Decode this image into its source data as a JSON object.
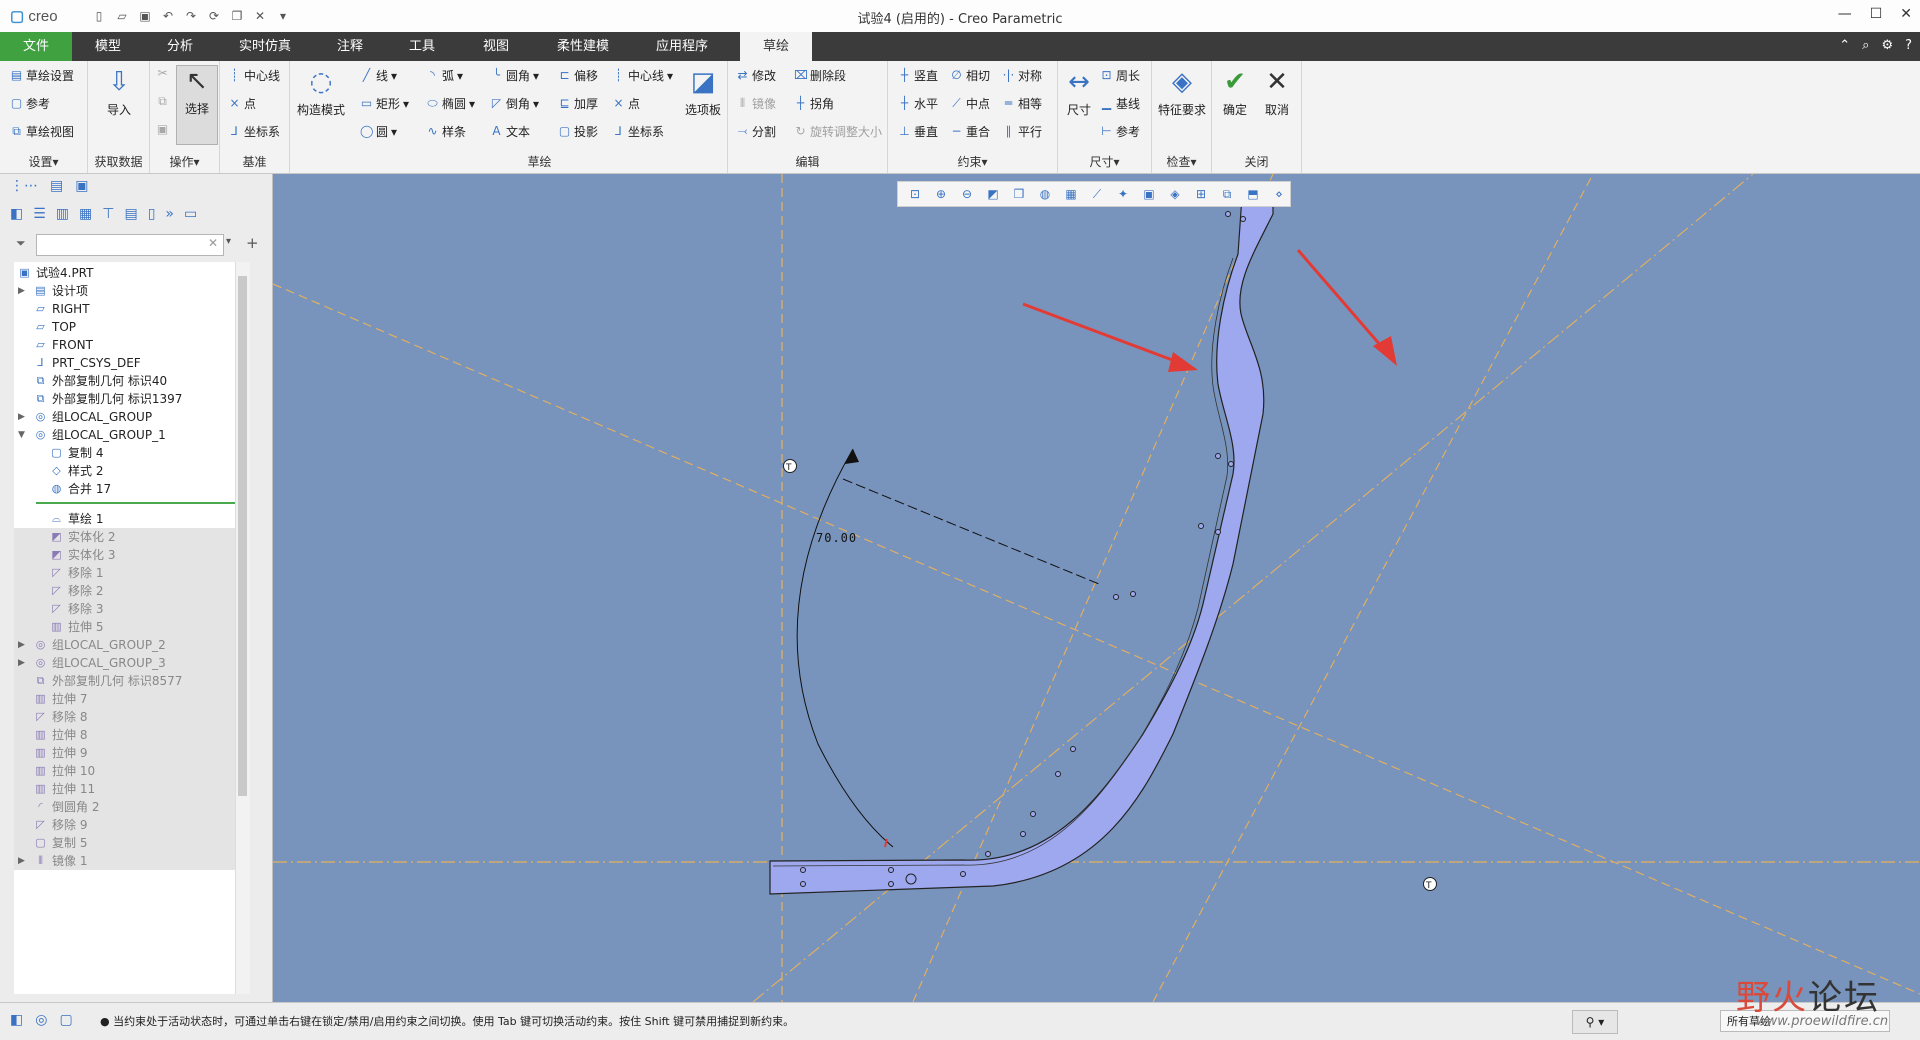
{
  "app": {
    "logo": "creo",
    "title": "试验4 (启用的) - Creo Parametric",
    "window_controls": [
      "minimize-icon",
      "maximize-icon",
      "close-icon"
    ]
  },
  "tabs": [
    {
      "label": "文件"
    },
    {
      "label": "模型"
    },
    {
      "label": "分析"
    },
    {
      "label": "实时仿真"
    },
    {
      "label": "注释"
    },
    {
      "label": "工具"
    },
    {
      "label": "视图"
    },
    {
      "label": "柔性建模"
    },
    {
      "label": "应用程序"
    },
    {
      "label": "草绘"
    }
  ],
  "ribbon": {
    "setup": {
      "label": "设置▾",
      "items": [
        "草绘设置",
        "参考",
        "草绘视图"
      ]
    },
    "getdata": {
      "label": "获取数据",
      "import": "导入"
    },
    "ops": {
      "label": "操作▾",
      "select": "选择"
    },
    "datum": {
      "label": "基准",
      "items": [
        "中心线",
        "点",
        "坐标系"
      ]
    },
    "construct": {
      "label": "构造模式"
    },
    "sketch": {
      "label": "草绘",
      "items": [
        "线",
        "弧",
        "圆角",
        "偏移",
        "中心线",
        "矩形",
        "椭圆",
        "倒角",
        "加厚",
        "点",
        "圆",
        "样条",
        "文本",
        "投影",
        "坐标系"
      ],
      "palette": "选项板"
    },
    "edit": {
      "label": "编辑",
      "items": [
        "修改",
        "删除段",
        "镜像",
        "拐角",
        "分割",
        "旋转调整大小"
      ]
    },
    "constrain": {
      "label": "约束▾",
      "items": [
        "竖直",
        "相切",
        "对称",
        "水平",
        "中点",
        "相等",
        "垂直",
        "重合",
        "平行"
      ]
    },
    "dimension": {
      "label": "尺寸▾",
      "dim": "尺寸",
      "items": [
        "周长",
        "基线",
        "参考"
      ]
    },
    "inspect": {
      "label": "检查▾",
      "feature_req": "特征要求"
    },
    "close": {
      "label": "关闭",
      "ok": "确定",
      "cancel": "取消"
    }
  },
  "tree": {
    "filter_placeholder": "",
    "items": [
      {
        "label": "试验4.PRT",
        "icon": "part-icon"
      },
      {
        "label": "设计项",
        "icon": "design-items-icon"
      },
      {
        "label": "RIGHT",
        "icon": "datum-plane-icon"
      },
      {
        "label": "TOP",
        "icon": "datum-plane-icon"
      },
      {
        "label": "FRONT",
        "icon": "datum-plane-icon"
      },
      {
        "label": "PRT_CSYS_DEF",
        "icon": "csys-icon"
      },
      {
        "label": "外部复制几何 标识40",
        "icon": "copy-geom-icon"
      },
      {
        "label": "外部复制几何 标识1397",
        "icon": "copy-geom-icon"
      },
      {
        "label": "组LOCAL_GROUP",
        "icon": "group-icon"
      },
      {
        "label": "组LOCAL_GROUP_1",
        "icon": "group-icon"
      },
      {
        "label": "复制 4",
        "icon": "copy-icon"
      },
      {
        "label": "样式 2",
        "icon": "style-icon"
      },
      {
        "label": "合并 17",
        "icon": "merge-icon"
      },
      {
        "label": "草绘 1",
        "icon": "sketch-icon"
      },
      {
        "label": "实体化 2",
        "icon": "solidify-icon"
      },
      {
        "label": "实体化 3",
        "icon": "solidify-icon"
      },
      {
        "label": "移除 1",
        "icon": "remove-icon"
      },
      {
        "label": "移除 2",
        "icon": "remove-icon"
      },
      {
        "label": "移除 3",
        "icon": "remove-icon"
      },
      {
        "label": "拉伸 5",
        "icon": "extrude-icon"
      },
      {
        "label": "组LOCAL_GROUP_2",
        "icon": "group-icon"
      },
      {
        "label": "组LOCAL_GROUP_3",
        "icon": "group-icon"
      },
      {
        "label": "外部复制几何 标识8577",
        "icon": "copy-geom-icon"
      },
      {
        "label": "拉伸 7",
        "icon": "extrude-icon"
      },
      {
        "label": "移除 8",
        "icon": "remove-icon"
      },
      {
        "label": "拉伸 8",
        "icon": "extrude-icon"
      },
      {
        "label": "拉伸 9",
        "icon": "extrude-icon"
      },
      {
        "label": "拉伸 10",
        "icon": "extrude-icon"
      },
      {
        "label": "拉伸 11",
        "icon": "extrude-icon"
      },
      {
        "label": "倒圆角 2",
        "icon": "round-icon"
      },
      {
        "label": "移除 9",
        "icon": "remove-icon"
      },
      {
        "label": "复制 5",
        "icon": "copy-icon"
      },
      {
        "label": "镜像 1",
        "icon": "mirror-icon"
      }
    ]
  },
  "canvas": {
    "dimension_value": "70.00",
    "colors": {
      "background": "#7894bd",
      "part_fill": "#9ea8ef",
      "ref_line": "#e8b15a",
      "arrow": "#e23b35"
    }
  },
  "status": {
    "message": "● 当约束处于活动状态时，可通过单击右键在锁定/禁用/启用约束之间切换。使用 Tab 键可切换活动约束。按住 Shift 键可禁用捕捉到新约束。",
    "selection": "所有草绘"
  },
  "watermark": {
    "text_a": "野火",
    "text_b": "论坛",
    "url": "www.proewildfire.cn"
  }
}
